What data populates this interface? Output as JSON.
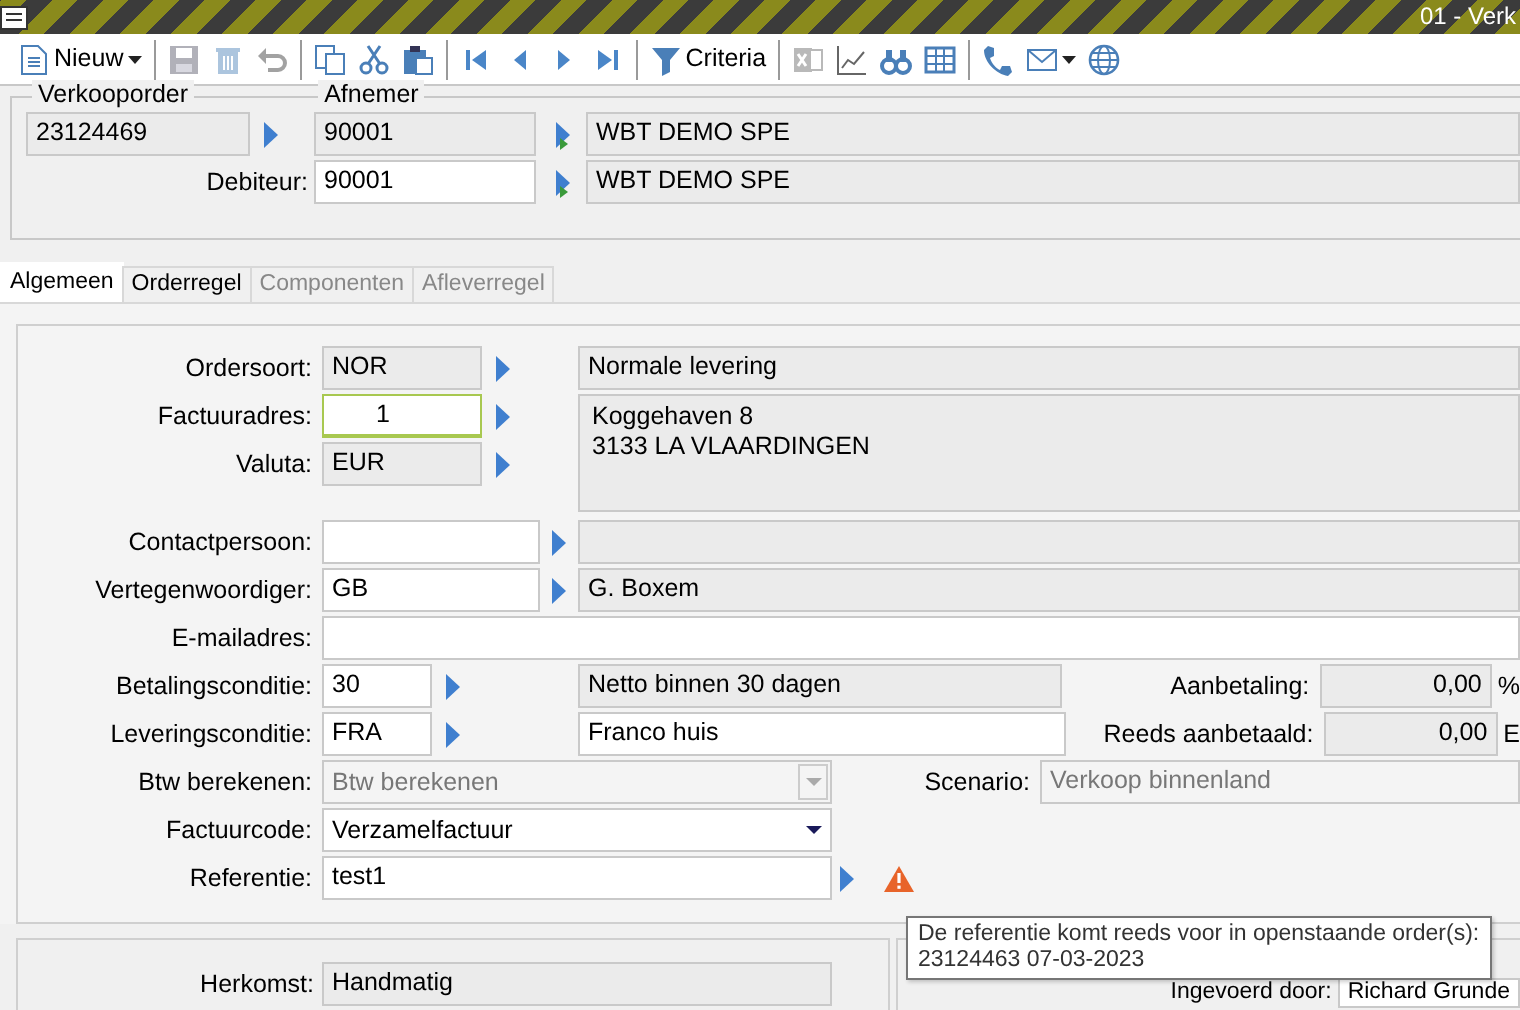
{
  "window": {
    "title": "01 - Verk"
  },
  "toolbar": {
    "groups": [
      [
        {
          "kind": "new",
          "label": "Nieuw",
          "disabled": false
        }
      ],
      [
        {
          "kind": "save",
          "disabled": true
        },
        {
          "kind": "delete",
          "disabled": true
        },
        {
          "kind": "undo",
          "disabled": true
        }
      ],
      [
        {
          "kind": "copy",
          "disabled": false
        },
        {
          "kind": "cut",
          "disabled": false
        },
        {
          "kind": "paste",
          "disabled": false
        }
      ],
      [
        {
          "kind": "first",
          "disabled": false
        },
        {
          "kind": "prev",
          "disabled": false
        },
        {
          "kind": "next",
          "disabled": false
        },
        {
          "kind": "last",
          "disabled": false
        }
      ],
      [
        {
          "kind": "criteria",
          "label": "Criteria",
          "disabled": false
        }
      ],
      [
        {
          "kind": "excel",
          "disabled": true
        },
        {
          "kind": "chart",
          "disabled": false
        },
        {
          "kind": "binoculars",
          "disabled": false
        },
        {
          "kind": "grid",
          "disabled": false
        }
      ],
      [
        {
          "kind": "phone",
          "disabled": false
        },
        {
          "kind": "mail",
          "disabled": false
        },
        {
          "kind": "globe",
          "disabled": false
        }
      ]
    ]
  },
  "header": {
    "order": {
      "legend": "Verkooporder",
      "number": "23124469"
    },
    "customer": {
      "legend": "Afnemer",
      "code": "90001",
      "name": "WBT DEMO SPE"
    },
    "debtor": {
      "label": "Debiteur:",
      "code": "90001",
      "name": "WBT DEMO SPE"
    }
  },
  "tabs": [
    {
      "label": "Algemeen",
      "selected": true,
      "disabled": false
    },
    {
      "label": "Orderregel",
      "selected": false,
      "disabled": false
    },
    {
      "label": "Componenten",
      "selected": false,
      "disabled": true
    },
    {
      "label": "Afleverregel",
      "selected": false,
      "disabled": true
    }
  ],
  "general": {
    "lookups_top": [
      {
        "label": "Ordersoort:",
        "value": "NOR",
        "readonly": true,
        "focused": false,
        "description": "Normale levering"
      },
      {
        "label": "Factuuradres:",
        "value": "1",
        "readonly": false,
        "focused": true
      },
      {
        "label": "Valuta:",
        "value": "EUR",
        "readonly": true,
        "focused": false
      }
    ],
    "address": [
      "Koggehaven 8",
      "3133 LA VLAARDINGEN"
    ],
    "contact": {
      "label": "Contactpersoon:"
    },
    "representative": {
      "label": "Vertegenwoordiger:",
      "value": "GB",
      "description": "G. Boxem"
    },
    "email": {
      "label": "E-mailadres:"
    },
    "payment": {
      "label": "Betalingsconditie:",
      "value": "30",
      "description": "Netto binnen 30 dagen",
      "description_readonly": true
    },
    "down_payment": {
      "label": "Aanbetaling:",
      "value": "0,00",
      "unit": "%"
    },
    "delivery": {
      "label": "Leveringsconditie:",
      "value": "FRA",
      "description": "Franco huis",
      "description_readonly": false
    },
    "paid": {
      "label": "Reeds aanbetaald:",
      "value": "0,00",
      "unit": "E"
    },
    "vat": {
      "label": "Btw berekenen:",
      "value": "Btw berekenen",
      "disabled": true
    },
    "scenario": {
      "label": "Scenario:",
      "value": "Verkoop binnenland",
      "disabled": true
    },
    "invoice_code": {
      "label": "Factuurcode:",
      "value": "Verzamelfactuur",
      "disabled": false
    },
    "reference": {
      "label": "Referentie:",
      "value": "test1",
      "warning": true
    }
  },
  "origin": {
    "label": "Herkomst:",
    "value": "Handmatig"
  },
  "entered_by": {
    "label": "Ingevoerd door:",
    "value": "Richard Grunde"
  },
  "tooltip": {
    "lines": [
      "De referentie komt reeds voor in openstaande order(s):",
      "23124463 07-03-2023"
    ]
  }
}
